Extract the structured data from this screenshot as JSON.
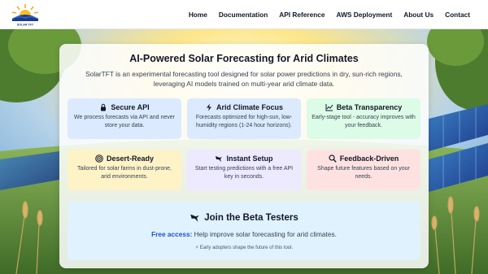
{
  "brand": {
    "logo_text": "SOLAR TFT"
  },
  "nav": [
    {
      "label": "Home"
    },
    {
      "label": "Documentation"
    },
    {
      "label": "API Reference"
    },
    {
      "label": "AWS Deployment"
    },
    {
      "label": "About Us"
    },
    {
      "label": "Contact"
    }
  ],
  "hero": {
    "title": "AI-Powered Solar Forecasting for Arid Climates",
    "description": "SolarTFT is an experimental forecasting tool designed for solar power predictions in dry, sun-rich regions, leveraging AI models trained on multi-year arid climate data."
  },
  "features": [
    {
      "icon": "lock-icon",
      "title": "Secure API",
      "text": "We process forecasts via API and never store your data."
    },
    {
      "icon": "bolt-icon",
      "title": "Arid Climate Focus",
      "text": "Forecasts optimized for high-sun, low-humidity regions (1-24 hour horizons)."
    },
    {
      "icon": "chart-icon",
      "title": "Beta Transparency",
      "text": "Early-stage tool - accuracy improves with your feedback."
    },
    {
      "icon": "target-icon",
      "title": "Desert-Ready",
      "text": "Tailored for solar farms in dust-prone, arid environments."
    },
    {
      "icon": "bird-icon",
      "title": "Instant Setup",
      "text": "Start testing predictions with a free API key in seconds."
    },
    {
      "icon": "magnifier-icon",
      "title": "Feedback-Driven",
      "text": "Shape future features based on your needs."
    }
  ],
  "beta": {
    "title": "Join the Beta Testers",
    "free_label": "Free access:",
    "free_text": " Help improve solar forecasting for arid climates.",
    "note": "⚡ Early adopters shape the future of this tool."
  },
  "colors": {
    "card_blue": "#dbeafe",
    "card_green": "#dcfce7",
    "card_yellow": "#fef3c7",
    "card_purple": "#ede9fe",
    "card_red": "#fee2e2",
    "beta_bg": "#e0f2fe",
    "link_blue": "#1d4ed8"
  }
}
